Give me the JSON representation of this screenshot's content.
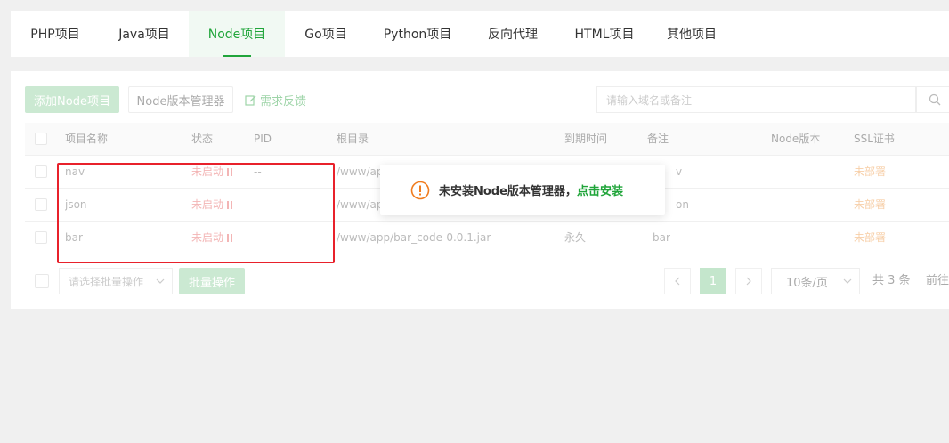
{
  "tabs": [
    {
      "label": "PHP项目"
    },
    {
      "label": "Java项目"
    },
    {
      "label": "Node项目",
      "active": true
    },
    {
      "label": "Go项目"
    },
    {
      "label": "Python项目"
    },
    {
      "label": "反向代理"
    },
    {
      "label": "HTML项目"
    },
    {
      "label": "其他项目"
    }
  ],
  "toolbar": {
    "add_label": "添加Node项目",
    "version_manager_label": "Node版本管理器",
    "feedback_label": "需求反馈",
    "search_placeholder": "请输入域名或备注"
  },
  "table": {
    "headers": {
      "name": "项目名称",
      "status": "状态",
      "pid": "PID",
      "root": "根目录",
      "expire": "到期时间",
      "remark": "备注",
      "node_version": "Node版本",
      "ssl": "SSL证书"
    },
    "rows": [
      {
        "name": "nav",
        "status": "未启动",
        "pid": "--",
        "root": "/www/ap",
        "expire": "",
        "remark": "v",
        "ssl": "未部署"
      },
      {
        "name": "json",
        "status": "未启动",
        "pid": "--",
        "root": "/www/ap",
        "expire": "",
        "remark": "on",
        "ssl": "未部署"
      },
      {
        "name": "bar",
        "status": "未启动",
        "pid": "--",
        "root": "/www/app/bar_code-0.0.1.jar",
        "expire": "永久",
        "remark": "bar",
        "ssl": "未部署"
      }
    ]
  },
  "footer": {
    "batch_select_placeholder": "请选择批量操作",
    "batch_button": "批量操作",
    "current_page": "1",
    "per_page": "10条/页",
    "total": "共 3 条",
    "goto": "前往"
  },
  "toast": {
    "message": "未安装Node版本管理器，",
    "link": "点击安装"
  },
  "colors": {
    "accent": "#20a53a",
    "warning": "#f07c1e",
    "highlight_border": "#e8212b"
  }
}
